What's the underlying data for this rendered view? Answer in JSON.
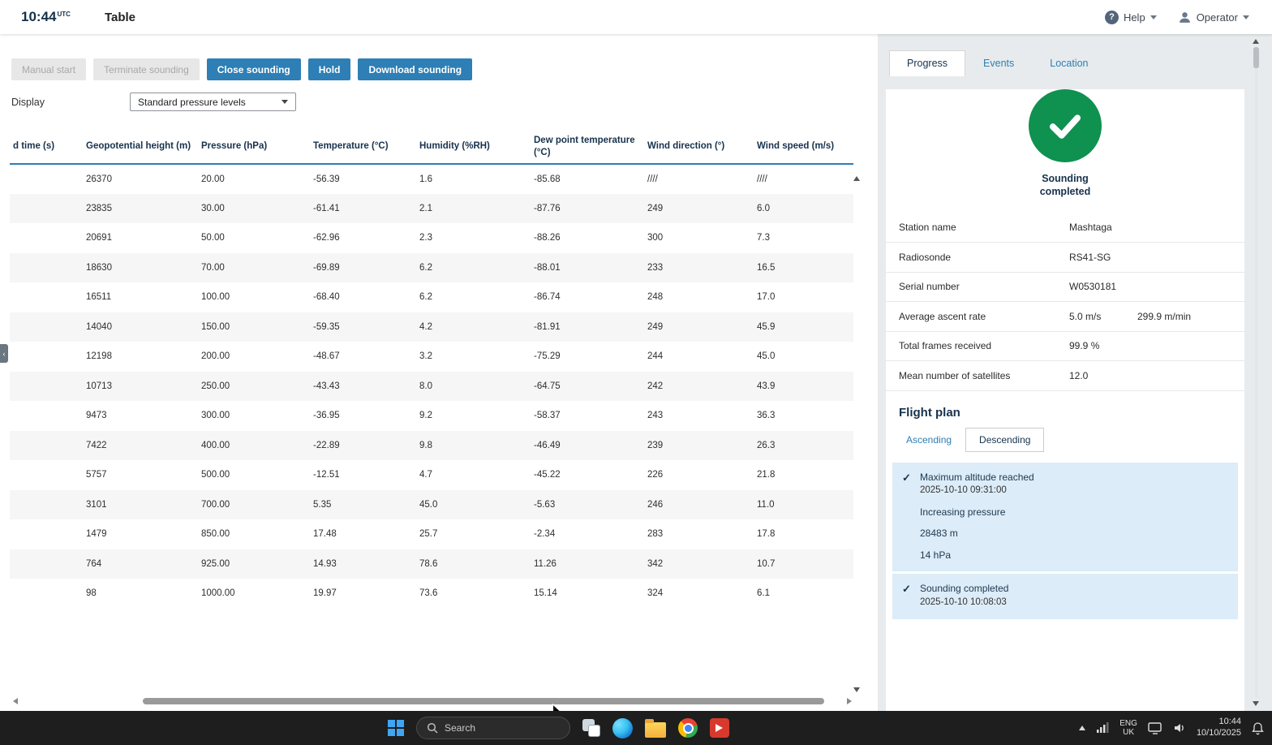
{
  "colors": {
    "primary_blue": "#2d7fb5",
    "success_green": "#0f9150",
    "event_highlight_blue": "#dcecf8",
    "disabled_gray": "#e7e7e7"
  },
  "icons": {
    "help": "?",
    "check": "✓",
    "collapse": "‹"
  },
  "header": {
    "time": "10:44",
    "time_zone": "UTC",
    "title": "Table",
    "help": "Help",
    "operator": "Operator"
  },
  "toolbar": {
    "buttons": [
      {
        "label": "Manual start",
        "state": "disabled"
      },
      {
        "label": "Terminate sounding",
        "state": "disabled"
      },
      {
        "label": "Close sounding",
        "state": "primary"
      },
      {
        "label": "Hold",
        "state": "primary"
      },
      {
        "label": "Download sounding",
        "state": "primary"
      }
    ],
    "display_label": "Display",
    "display_value": "Standard pressure levels"
  },
  "table": {
    "columns": [
      "d time (s)",
      "Geopotential height (m)",
      "Pressure (hPa)",
      "Temperature (°C)",
      "Humidity (%RH)",
      "Dew point temperature (°C)",
      "Wind direction (°)",
      "Wind speed (m/s)"
    ],
    "rows": [
      [
        "",
        "26370",
        "20.00",
        "-56.39",
        "1.6",
        "-85.68",
        "////",
        "////"
      ],
      [
        "",
        "23835",
        "30.00",
        "-61.41",
        "2.1",
        "-87.76",
        "249",
        "6.0"
      ],
      [
        "",
        "20691",
        "50.00",
        "-62.96",
        "2.3",
        "-88.26",
        "300",
        "7.3"
      ],
      [
        "",
        "18630",
        "70.00",
        "-69.89",
        "6.2",
        "-88.01",
        "233",
        "16.5"
      ],
      [
        "",
        "16511",
        "100.00",
        "-68.40",
        "6.2",
        "-86.74",
        "248",
        "17.0"
      ],
      [
        "",
        "14040",
        "150.00",
        "-59.35",
        "4.2",
        "-81.91",
        "249",
        "45.9"
      ],
      [
        "",
        "12198",
        "200.00",
        "-48.67",
        "3.2",
        "-75.29",
        "244",
        "45.0"
      ],
      [
        "",
        "10713",
        "250.00",
        "-43.43",
        "8.0",
        "-64.75",
        "242",
        "43.9"
      ],
      [
        "",
        "9473",
        "300.00",
        "-36.95",
        "9.2",
        "-58.37",
        "243",
        "36.3"
      ],
      [
        "",
        "7422",
        "400.00",
        "-22.89",
        "9.8",
        "-46.49",
        "239",
        "26.3"
      ],
      [
        "",
        "5757",
        "500.00",
        "-12.51",
        "4.7",
        "-45.22",
        "226",
        "21.8"
      ],
      [
        "",
        "3101",
        "700.00",
        "5.35",
        "45.0",
        "-5.63",
        "246",
        "11.0"
      ],
      [
        "",
        "1479",
        "850.00",
        "17.48",
        "25.7",
        "-2.34",
        "283",
        "17.8"
      ],
      [
        "",
        "764",
        "925.00",
        "14.93",
        "78.6",
        "11.26",
        "342",
        "10.7"
      ],
      [
        "",
        "98",
        "1000.00",
        "19.97",
        "73.6",
        "15.14",
        "324",
        "6.1"
      ]
    ]
  },
  "panel": {
    "tabs": [
      "Progress",
      "Events",
      "Location"
    ],
    "active_tab": "Progress",
    "status_text": "Sounding completed",
    "info": [
      {
        "label": "Station name",
        "value": "Mashtaga"
      },
      {
        "label": "Radiosonde",
        "value": "RS41-SG"
      },
      {
        "label": "Serial number",
        "value": "W0530181"
      },
      {
        "label": "Average ascent rate",
        "value": "5.0 m/s",
        "value2": "299.9 m/min"
      },
      {
        "label": "Total frames received",
        "value": "99.9 %"
      },
      {
        "label": "Mean number of satellites",
        "value": "12.0"
      }
    ],
    "flight_plan": {
      "title": "Flight plan",
      "tabs": [
        "Ascending",
        "Descending"
      ],
      "active_tab": "Descending",
      "groups": [
        {
          "items": [
            {
              "check": true,
              "title": "Maximum altitude reached",
              "time": "2025-10-10 09:31:00"
            },
            {
              "check": false,
              "title": "Increasing pressure"
            },
            {
              "check": false,
              "title": "28483 m"
            },
            {
              "check": false,
              "title": "14 hPa"
            }
          ]
        },
        {
          "items": [
            {
              "check": true,
              "title": "Sounding completed",
              "time": "2025-10-10 10:08:03"
            }
          ]
        }
      ]
    }
  },
  "taskbar": {
    "search_placeholder": "Search",
    "language_line1": "ENG",
    "language_line2": "UK",
    "time": "10:44",
    "date": "10/10/2025"
  }
}
